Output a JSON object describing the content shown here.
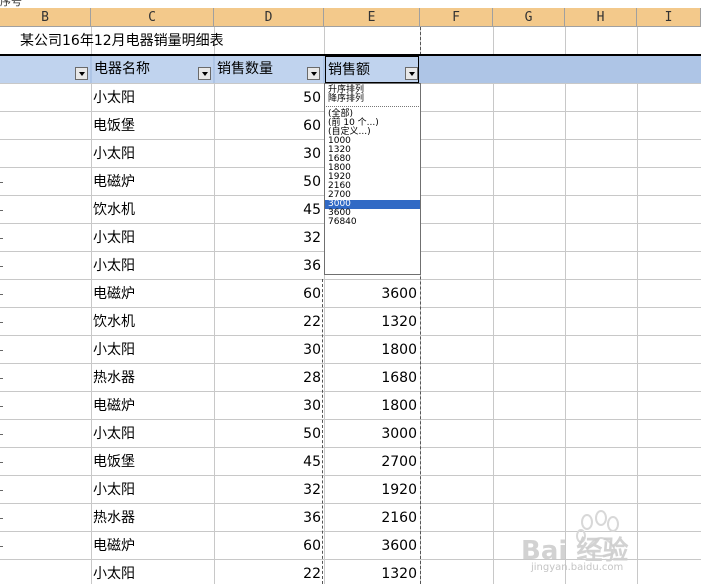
{
  "formula_fragment": "序号",
  "columns": [
    "B",
    "C",
    "D",
    "E",
    "F",
    "G",
    "H",
    "I"
  ],
  "title": "某公司16年12月电器销量明细表",
  "headers": {
    "name": "电器名称",
    "qty": "销售数量",
    "amt": "销售额"
  },
  "dropdown": {
    "sort": [
      "升序排列",
      "降序排列"
    ],
    "options": [
      "(全部)",
      "(前 10 个...)",
      "(自定义...)",
      "1000",
      "1320",
      "1680",
      "1800",
      "1920",
      "2160",
      "2700",
      "3000",
      "3600",
      "76840"
    ],
    "selected": "3000"
  },
  "rows": [
    {
      "name": "小太阳",
      "qty": "50",
      "amt": ""
    },
    {
      "name": "电饭堡",
      "qty": "60",
      "amt": ""
    },
    {
      "name": "小太阳",
      "qty": "30",
      "amt": ""
    },
    {
      "name": "电磁炉",
      "qty": "50",
      "amt": ""
    },
    {
      "name": "饮水机",
      "qty": "45",
      "amt": ""
    },
    {
      "name": "小太阳",
      "qty": "32",
      "amt": ""
    },
    {
      "name": "小太阳",
      "qty": "36",
      "amt": ""
    },
    {
      "name": "电磁炉",
      "qty": "60",
      "amt": "3600"
    },
    {
      "name": "饮水机",
      "qty": "22",
      "amt": "1320"
    },
    {
      "name": "小太阳",
      "qty": "30",
      "amt": "1800"
    },
    {
      "name": "热水器",
      "qty": "28",
      "amt": "1680"
    },
    {
      "name": "电磁炉",
      "qty": "30",
      "amt": "1800"
    },
    {
      "name": "小太阳",
      "qty": "50",
      "amt": "3000"
    },
    {
      "name": "电饭堡",
      "qty": "45",
      "amt": "2700"
    },
    {
      "name": "小太阳",
      "qty": "32",
      "amt": "1920"
    },
    {
      "name": "热水器",
      "qty": "36",
      "amt": "2160"
    },
    {
      "name": "电磁炉",
      "qty": "60",
      "amt": "3600"
    },
    {
      "name": "小太阳",
      "qty": "22",
      "amt": "1320"
    }
  ],
  "watermark": {
    "brand": "Bai 经验",
    "url": "jingyan.baidu.com"
  }
}
